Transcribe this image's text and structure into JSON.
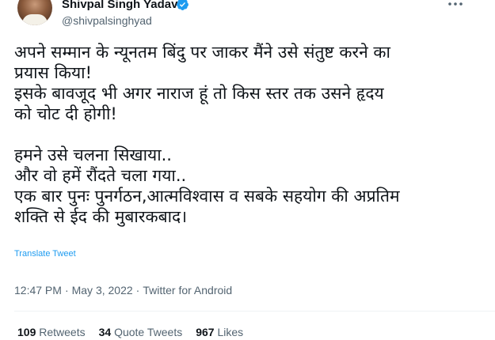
{
  "author": {
    "display_name": "Shivpal Singh Yadav",
    "handle": "@shivpalsinghyad",
    "verified": true
  },
  "tweet": {
    "text": "अपने सम्मान के न्यूनतम बिंदु पर जाकर मैंने उसे संतुष्ट करने का\nप्रयास किया!\nइसके बावजूद भी अगर नाराज हूं तो किस स्तर तक उसने हृदय\nको चोट दी होगी!\n\nहमने उसे चलना सिखाया..\nऔर वो हमें रौंदते चला गया..\nएक बार पुनः पुनर्गठन,आत्मविश्वास व सबके सहयोग की अप्रतिम\nशक्ति से ईद की मुबारकबाद।",
    "translate_label": "Translate Tweet"
  },
  "meta": {
    "time": "12:47 PM",
    "separator": "·",
    "date": "May 3, 2022",
    "source": "Twitter for Android"
  },
  "stats": {
    "retweets_count": "109",
    "retweets_label": "Retweets",
    "quotes_count": "34",
    "quotes_label": "Quote Tweets",
    "likes_count": "967",
    "likes_label": "Likes"
  },
  "colors": {
    "text": "#0f1419",
    "secondary": "#536471",
    "accent": "#1d9bf0",
    "divider": "#eff3f4"
  },
  "icons": {
    "verified": "verified-badge-icon",
    "more": "more-options-icon"
  }
}
